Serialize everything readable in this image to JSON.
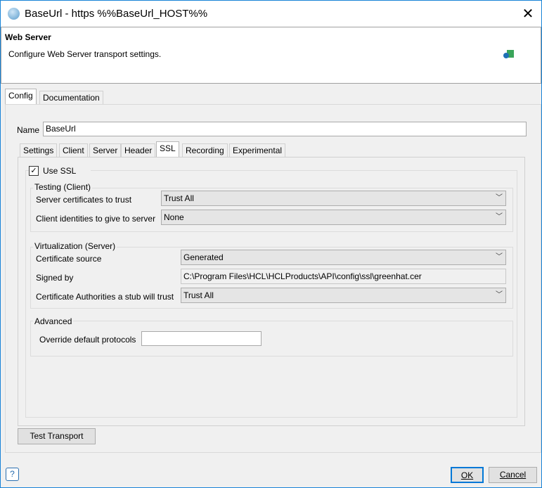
{
  "window": {
    "title": "BaseUrl - https %%BaseUrl_HOST%%",
    "close_icon": "close-icon",
    "app_icon": "globe-icon"
  },
  "header": {
    "title": "Web Server",
    "description": "Configure Web Server transport settings.",
    "icon": "transport-icon"
  },
  "outer_tabs": [
    {
      "label": "Config",
      "selected": true
    },
    {
      "label": "Documentation",
      "selected": false
    }
  ],
  "name": {
    "label": "Name",
    "value": "BaseUrl"
  },
  "inner_tabs": [
    {
      "label": "Settings"
    },
    {
      "label": "Client"
    },
    {
      "label": "Server"
    },
    {
      "label": "Header"
    },
    {
      "label": "SSL",
      "selected": true
    },
    {
      "label": "Recording"
    },
    {
      "label": "Experimental"
    }
  ],
  "ssl": {
    "use_ssl": {
      "label": "Use SSL",
      "checked": true
    },
    "testing": {
      "title": "Testing (Client)",
      "server_certs_label": "Server certificates to trust",
      "server_certs_value": "Trust All",
      "client_ids_label": "Client identities to give to server",
      "client_ids_value": "None"
    },
    "virtualization": {
      "title": "Virtualization (Server)",
      "cert_source_label": "Certificate source",
      "cert_source_value": "Generated",
      "signed_by_label": "Signed by",
      "signed_by_value": "C:\\Program Files\\HCL\\HCLProducts\\API\\config\\ssl\\greenhat.cer",
      "ca_label": "Certificate Authorities a stub will trust",
      "ca_value": "Trust All"
    },
    "advanced": {
      "title": "Advanced",
      "override_label": "Override default protocols",
      "override_value": ""
    }
  },
  "buttons": {
    "test_transport": "Test Transport",
    "ok": "OK",
    "cancel": "Cancel",
    "help": "?"
  }
}
